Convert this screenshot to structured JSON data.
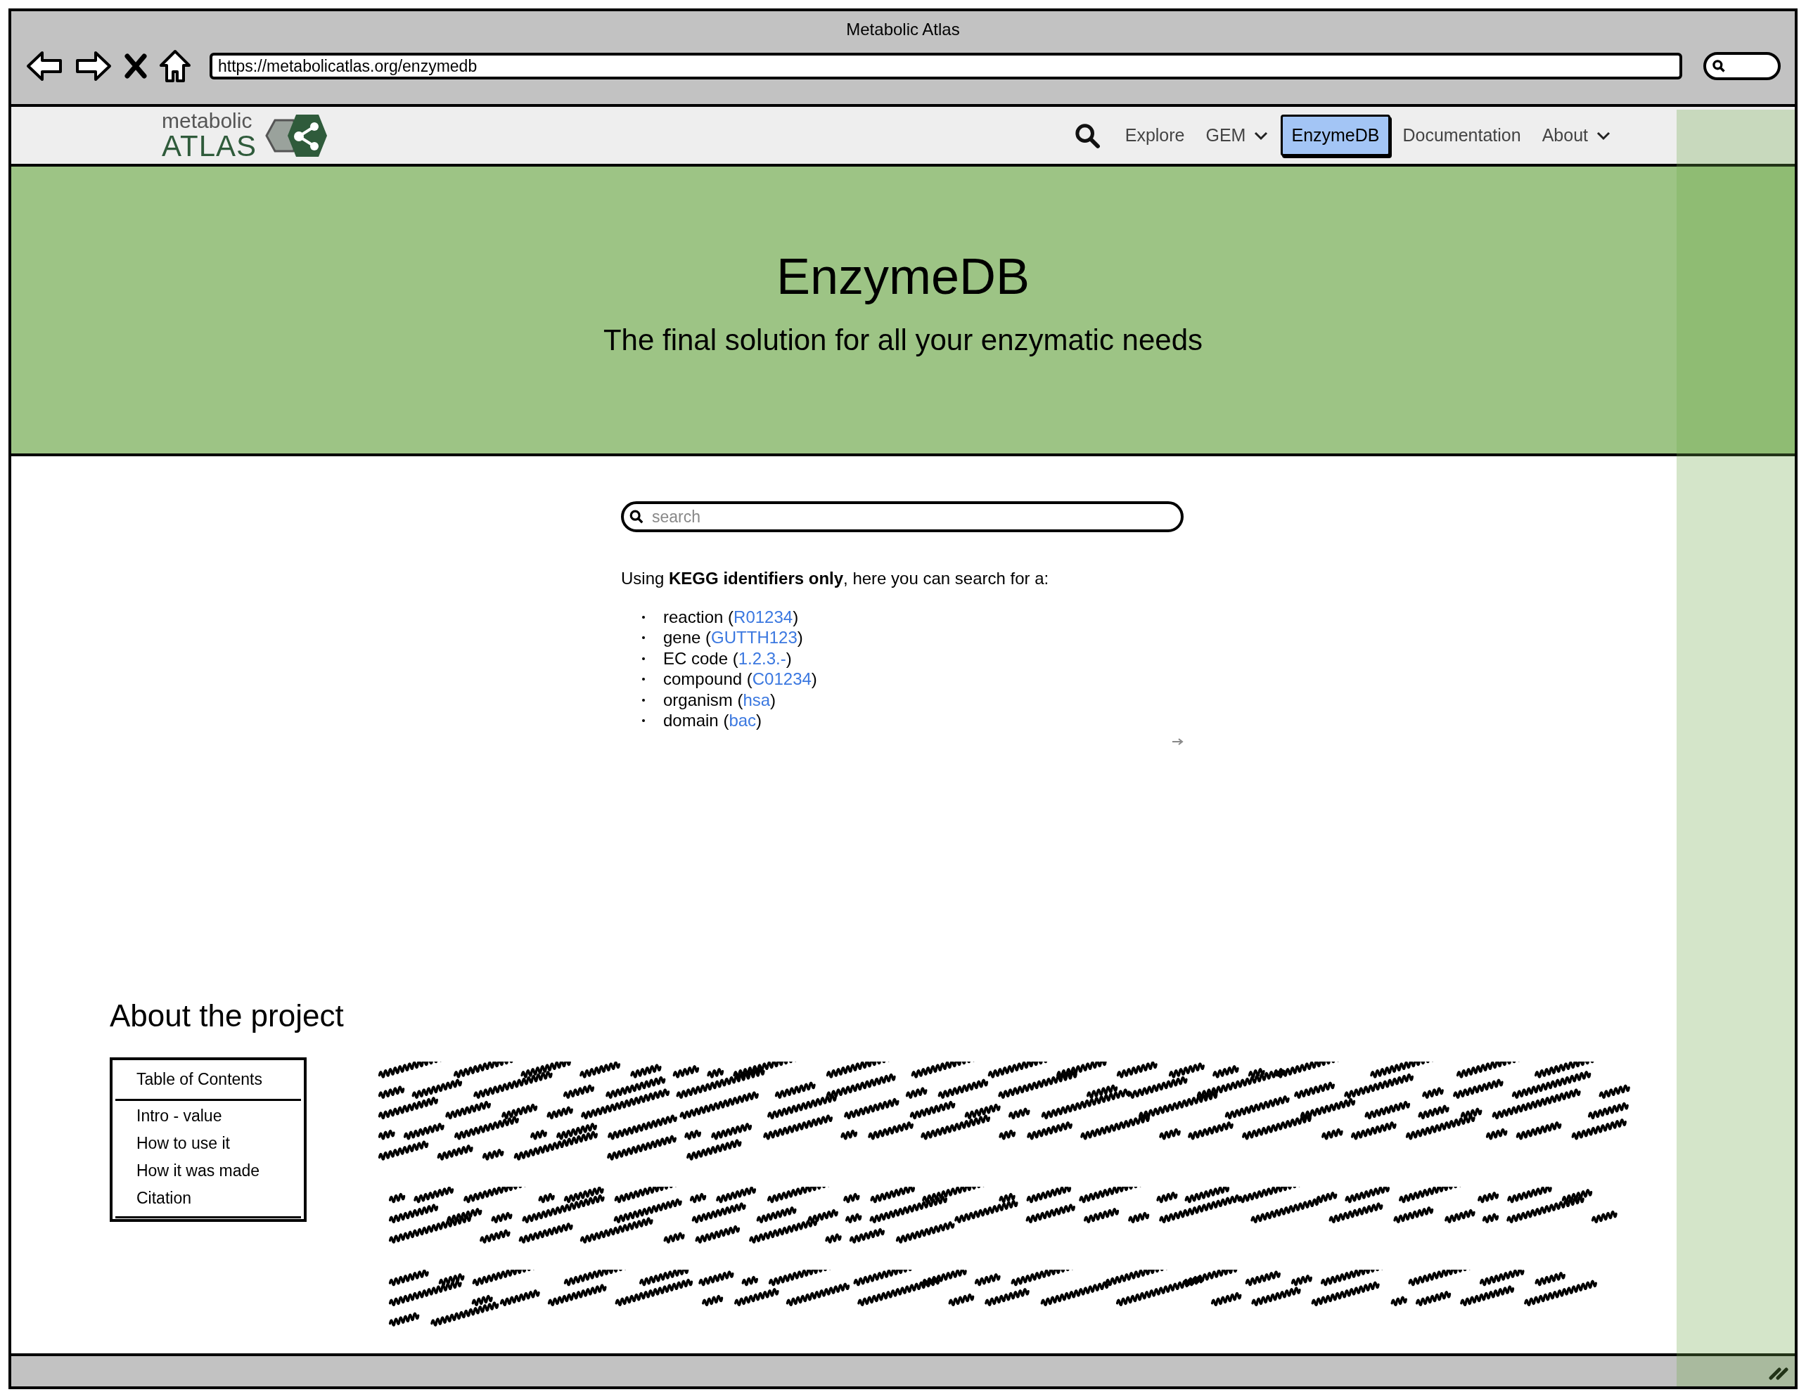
{
  "window": {
    "title": "Metabolic Atlas",
    "url": "https://metabolicatlas.org/enzymedb"
  },
  "logo": {
    "top": "metabolic",
    "bottom": "ATLAS"
  },
  "nav": [
    {
      "kind": "search"
    },
    {
      "kind": "link",
      "label": "Explore",
      "selected": false
    },
    {
      "kind": "dropdown",
      "label": "GEM",
      "selected": false
    },
    {
      "kind": "link",
      "label": "EnzymeDB",
      "selected": true
    },
    {
      "kind": "link",
      "label": "Documentation",
      "selected": false
    },
    {
      "kind": "dropdown",
      "label": "About",
      "selected": false
    }
  ],
  "hero": {
    "title": "EnzymeDB",
    "subtitle": "The final solution for all your enzymatic needs"
  },
  "search": {
    "placeholder": "search"
  },
  "intro": "Using **KEGG identifiers only**, here you can search for a:",
  "examples": [
    {
      "label": "reaction (",
      "code": "R01234",
      "tail": ")"
    },
    {
      "label": "gene (",
      "code": "GUTTH123",
      "tail": ")"
    },
    {
      "label": "EC code (",
      "code": "1.2.3.-",
      "tail": ")"
    },
    {
      "label": "compound (",
      "code": "C01234",
      "tail": ")"
    },
    {
      "label": "organism (",
      "code": "hsa",
      "tail": ")"
    },
    {
      "label": "domain (",
      "code": "bac",
      "tail": ")"
    }
  ],
  "about": {
    "heading": "About the project",
    "toc": {
      "title": "Table of Contents",
      "items": [
        "Intro - value",
        "How to use it",
        "How it was made",
        "Citation"
      ]
    }
  }
}
